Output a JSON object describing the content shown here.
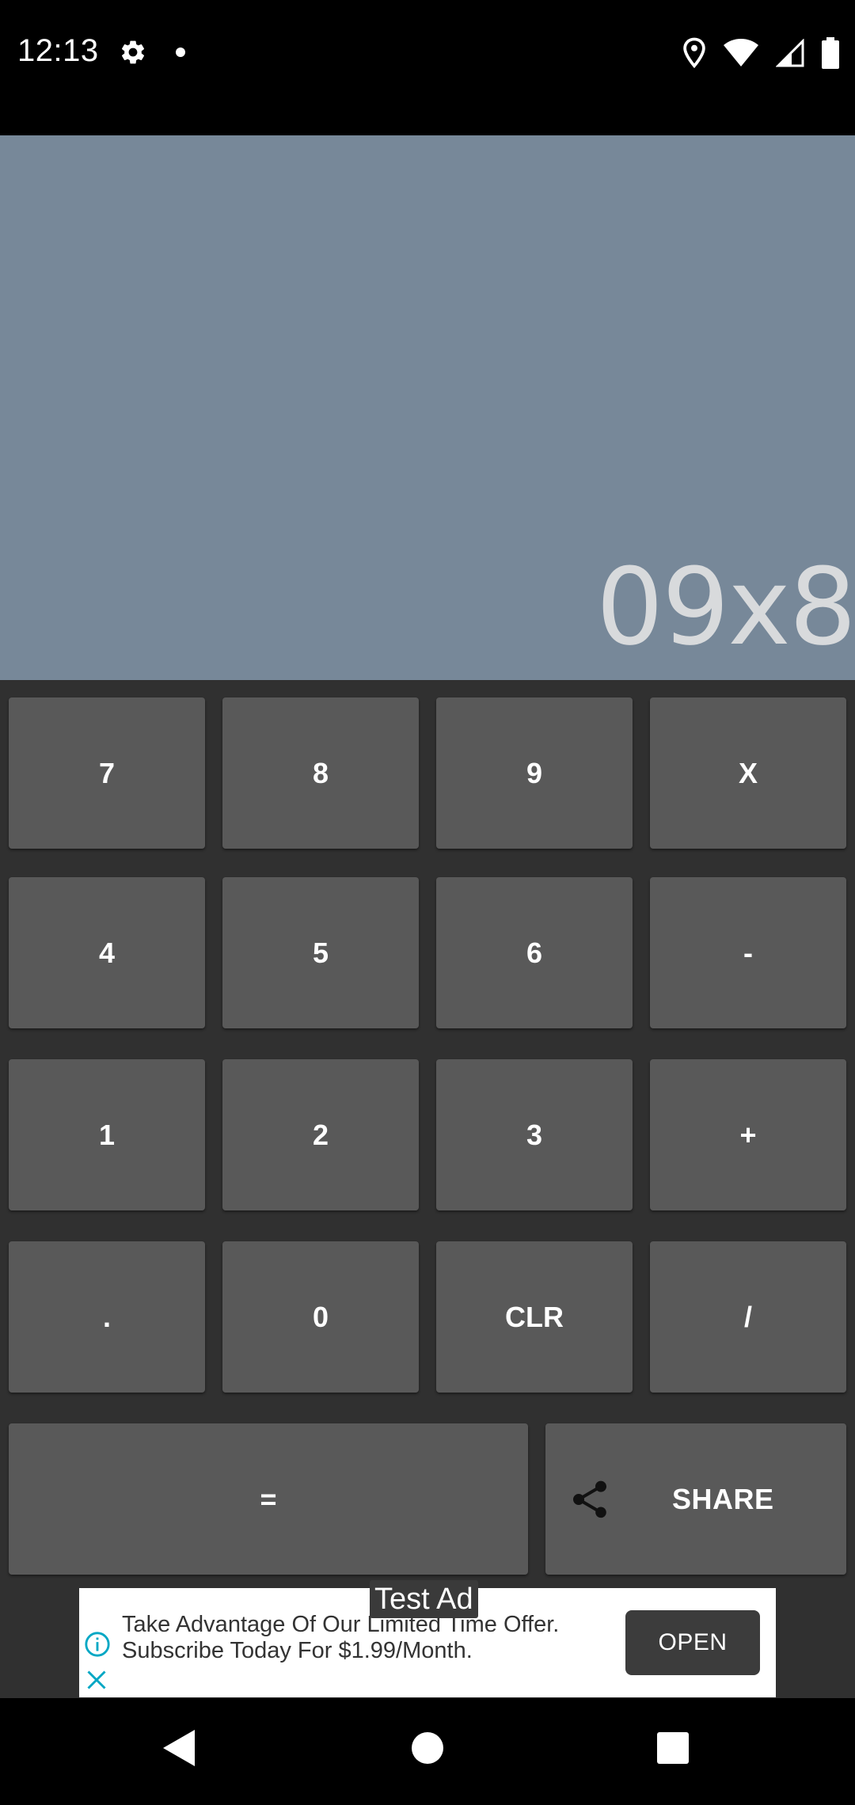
{
  "status_bar": {
    "time": "12:13",
    "icons": [
      "gear-icon",
      "notification-dot",
      "location-icon",
      "wifi-icon",
      "signal-icon",
      "battery-icon"
    ]
  },
  "display": {
    "expression": "09x8",
    "background": "#778899",
    "text_color": "#d8dadc"
  },
  "keypad": {
    "key_color": "#595959",
    "rows": [
      [
        "7",
        "8",
        "9",
        "X"
      ],
      [
        "4",
        "5",
        "6",
        "-"
      ],
      [
        "1",
        "2",
        "3",
        "+"
      ],
      [
        ".",
        "0",
        "CLR",
        "/"
      ]
    ],
    "equals": "=",
    "share": "SHARE"
  },
  "ad": {
    "label": "Test Ad",
    "text": "Take Advantage Of Our Limited Time Offer. Subscribe Today For $1.99/Month.",
    "button": "OPEN"
  },
  "nav_bar": {
    "buttons": [
      "back-icon",
      "home-icon",
      "recents-icon"
    ]
  }
}
